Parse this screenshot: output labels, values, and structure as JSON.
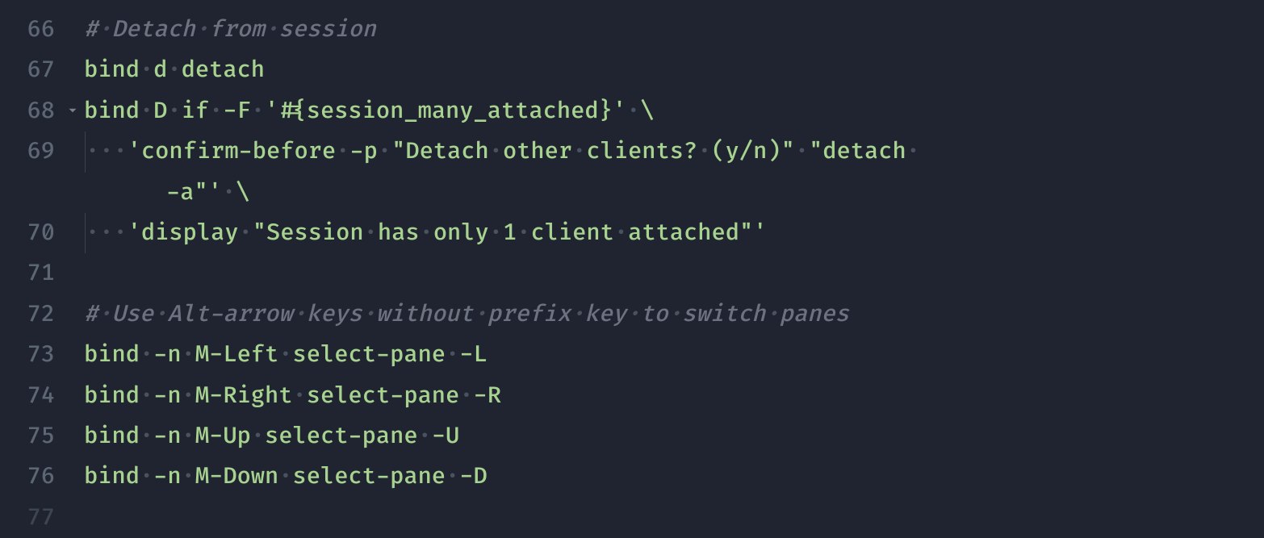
{
  "lines": [
    {
      "num": "66",
      "fold": false,
      "segments": [
        {
          "cls": "comment",
          "text": "# Detach from session"
        }
      ],
      "prefixDots": 0
    },
    {
      "num": "67",
      "fold": false,
      "segments": [
        {
          "cls": "txt",
          "text": "bind"
        },
        {
          "cls": "ws-dot",
          "text": "·"
        },
        {
          "cls": "txt",
          "text": "d"
        },
        {
          "cls": "ws-dot",
          "text": "·"
        },
        {
          "cls": "txt",
          "text": "detach"
        }
      ],
      "prefixDots": 0
    },
    {
      "num": "68",
      "fold": true,
      "segments": [
        {
          "cls": "txt",
          "text": "bind"
        },
        {
          "cls": "ws-dot",
          "text": "·"
        },
        {
          "cls": "txt",
          "text": "D"
        },
        {
          "cls": "ws-dot",
          "text": "·"
        },
        {
          "cls": "txt",
          "text": "if"
        },
        {
          "cls": "ws-dot",
          "text": "·"
        },
        {
          "cls": "txt",
          "text": "-F"
        },
        {
          "cls": "ws-dot",
          "text": "·"
        },
        {
          "cls": "str",
          "text": "'#{session_many_attached}'"
        },
        {
          "cls": "ws-dot",
          "text": "·"
        },
        {
          "cls": "txt",
          "text": "\\"
        }
      ],
      "prefixDots": 0
    },
    {
      "num": "69",
      "fold": false,
      "indentGuide": true,
      "segments": [
        {
          "cls": "str",
          "text": "'confirm-before"
        },
        {
          "cls": "ws-dot",
          "text": "·"
        },
        {
          "cls": "str",
          "text": "-p"
        },
        {
          "cls": "ws-dot",
          "text": "·"
        },
        {
          "cls": "str",
          "text": "\"Detach"
        },
        {
          "cls": "ws-dot",
          "text": "·"
        },
        {
          "cls": "str",
          "text": "other"
        },
        {
          "cls": "ws-dot",
          "text": "·"
        },
        {
          "cls": "str",
          "text": "clients?"
        },
        {
          "cls": "ws-dot",
          "text": "·"
        },
        {
          "cls": "str",
          "text": "(y/n)\""
        },
        {
          "cls": "ws-dot",
          "text": "·"
        },
        {
          "cls": "str",
          "text": "\"detach"
        },
        {
          "cls": "ws-dot",
          "text": "·"
        }
      ],
      "prefixDots": 4,
      "wrap": [
        {
          "cls": "str",
          "text": "-a\"'"
        },
        {
          "cls": "ws-dot",
          "text": "·"
        },
        {
          "cls": "txt",
          "text": "\\"
        }
      ],
      "wrapIndent": 4
    },
    {
      "num": "70",
      "fold": false,
      "indentGuide": true,
      "segments": [
        {
          "cls": "str",
          "text": "'display"
        },
        {
          "cls": "ws-dot",
          "text": "·"
        },
        {
          "cls": "str",
          "text": "\"Session"
        },
        {
          "cls": "ws-dot",
          "text": "·"
        },
        {
          "cls": "str",
          "text": "has"
        },
        {
          "cls": "ws-dot",
          "text": "·"
        },
        {
          "cls": "str",
          "text": "only"
        },
        {
          "cls": "ws-dot",
          "text": "·"
        },
        {
          "cls": "str",
          "text": "1"
        },
        {
          "cls": "ws-dot",
          "text": "·"
        },
        {
          "cls": "str",
          "text": "client"
        },
        {
          "cls": "ws-dot",
          "text": "·"
        },
        {
          "cls": "str",
          "text": "attached\"'"
        }
      ],
      "prefixDots": 4
    },
    {
      "num": "71",
      "fold": false,
      "segments": [],
      "prefixDots": 0
    },
    {
      "num": "72",
      "fold": false,
      "segments": [
        {
          "cls": "comment",
          "text": "# Use Alt-arrow keys without prefix key to switch panes"
        }
      ],
      "prefixDots": 0
    },
    {
      "num": "73",
      "fold": false,
      "segments": [
        {
          "cls": "txt",
          "text": "bind"
        },
        {
          "cls": "ws-dot",
          "text": "·"
        },
        {
          "cls": "txt",
          "text": "-n"
        },
        {
          "cls": "ws-dot",
          "text": "·"
        },
        {
          "cls": "txt",
          "text": "M-Left"
        },
        {
          "cls": "ws-dot",
          "text": "·"
        },
        {
          "cls": "txt",
          "text": "select-pane"
        },
        {
          "cls": "ws-dot",
          "text": "·"
        },
        {
          "cls": "txt",
          "text": "-L"
        }
      ],
      "prefixDots": 0
    },
    {
      "num": "74",
      "fold": false,
      "segments": [
        {
          "cls": "txt",
          "text": "bind"
        },
        {
          "cls": "ws-dot",
          "text": "·"
        },
        {
          "cls": "txt",
          "text": "-n"
        },
        {
          "cls": "ws-dot",
          "text": "·"
        },
        {
          "cls": "txt",
          "text": "M-Right"
        },
        {
          "cls": "ws-dot",
          "text": "·"
        },
        {
          "cls": "txt",
          "text": "select-pane"
        },
        {
          "cls": "ws-dot",
          "text": "·"
        },
        {
          "cls": "txt",
          "text": "-R"
        }
      ],
      "prefixDots": 0
    },
    {
      "num": "75",
      "fold": false,
      "segments": [
        {
          "cls": "txt",
          "text": "bind"
        },
        {
          "cls": "ws-dot",
          "text": "·"
        },
        {
          "cls": "txt",
          "text": "-n"
        },
        {
          "cls": "ws-dot",
          "text": "·"
        },
        {
          "cls": "txt",
          "text": "M-Up"
        },
        {
          "cls": "ws-dot",
          "text": "·"
        },
        {
          "cls": "txt",
          "text": "select-pane"
        },
        {
          "cls": "ws-dot",
          "text": "·"
        },
        {
          "cls": "txt",
          "text": "-U"
        }
      ],
      "prefixDots": 0
    },
    {
      "num": "76",
      "fold": false,
      "segments": [
        {
          "cls": "txt",
          "text": "bind"
        },
        {
          "cls": "ws-dot",
          "text": "·"
        },
        {
          "cls": "txt",
          "text": "-n"
        },
        {
          "cls": "ws-dot",
          "text": "·"
        },
        {
          "cls": "txt",
          "text": "M-Down"
        },
        {
          "cls": "ws-dot",
          "text": "·"
        },
        {
          "cls": "txt",
          "text": "select-pane"
        },
        {
          "cls": "ws-dot",
          "text": "·"
        },
        {
          "cls": "txt",
          "text": "-D"
        }
      ],
      "prefixDots": 0
    },
    {
      "num": "77",
      "fold": false,
      "segments": [],
      "prefixDots": 0,
      "faded": true
    }
  ]
}
